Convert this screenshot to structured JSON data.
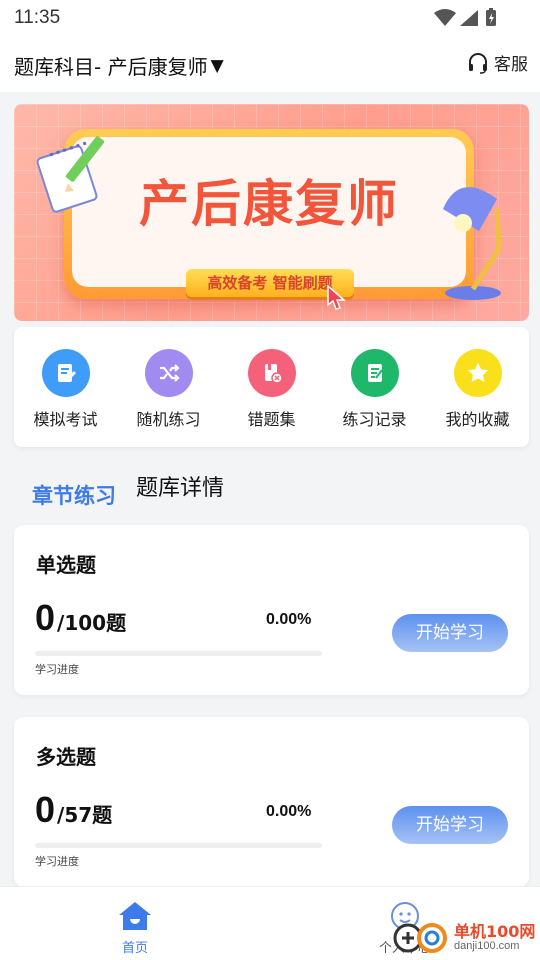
{
  "status": {
    "time": "11:35"
  },
  "header": {
    "subject": "题库科目- 产后康复师",
    "caret": "▼",
    "service_label": "客服"
  },
  "banner": {
    "title": "产后康复师",
    "tagline": "高效备考 智能刷题"
  },
  "quick_actions": [
    {
      "label": "模拟考试",
      "icon": "exam-icon",
      "color": "#3f9cf8"
    },
    {
      "label": "随机练习",
      "icon": "shuffle-icon",
      "color": "#a28bf0"
    },
    {
      "label": "错题集",
      "icon": "error-set-icon",
      "color": "#f5617a"
    },
    {
      "label": "练习记录",
      "icon": "record-icon",
      "color": "#1fb86a"
    },
    {
      "label": "我的收藏",
      "icon": "star-icon",
      "color": "#f9e01b"
    }
  ],
  "tabs": {
    "active": "章节练习",
    "other": "题库详情"
  },
  "cards": [
    {
      "title": "单选题",
      "done": "0",
      "total": "/100题",
      "percent": "0.00%",
      "progress": 0,
      "progress_label": "学习进度",
      "button": "开始学习"
    },
    {
      "title": "多选题",
      "done": "0",
      "total": "/57题",
      "percent": "0.00%",
      "progress": 0,
      "progress_label": "学习进度",
      "button": "开始学习"
    }
  ],
  "nav": {
    "home": "首页",
    "me": "个人中心"
  },
  "watermark": {
    "title": "单机100网",
    "url": "danji100.com"
  },
  "colors": {
    "accent": "#3e7bea",
    "banner_title": "#f2553a"
  }
}
